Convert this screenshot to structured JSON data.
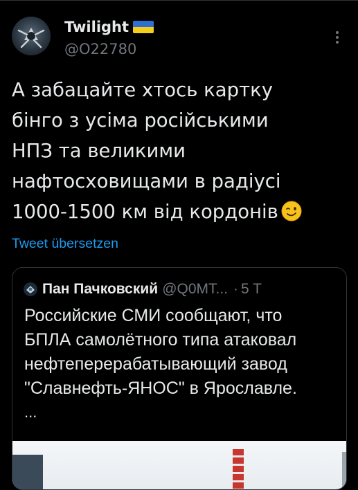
{
  "tweet": {
    "display_name": "Twilight",
    "flag_icon": "ukraine-flag-icon",
    "handle": "@O22780",
    "text": "А забацайте хтось картку\nбінго з усіма російськими\nНПЗ та великими\nнафтосховищами в радіусі\n1000-1500 км від кордонів",
    "emoji_icon": "winking-face-icon",
    "translate_label": "Tweet übersetzen"
  },
  "quote": {
    "name": "Пан Пачковский",
    "handle": "@Q0MT...",
    "separator": "·",
    "time": "5 T",
    "text": "Российские СМИ сообщают, что\nБПЛА самолётного типа атаковал\nнефтеперерабатывающий завод\n\"Славнефть-ЯНОС\" в Ярославле.",
    "ellipsis": "..."
  },
  "colors": {
    "background": "#000000",
    "text": "#e7e9ea",
    "secondary": "#71767b",
    "link": "#1d9bf0",
    "border": "#2f3336"
  }
}
